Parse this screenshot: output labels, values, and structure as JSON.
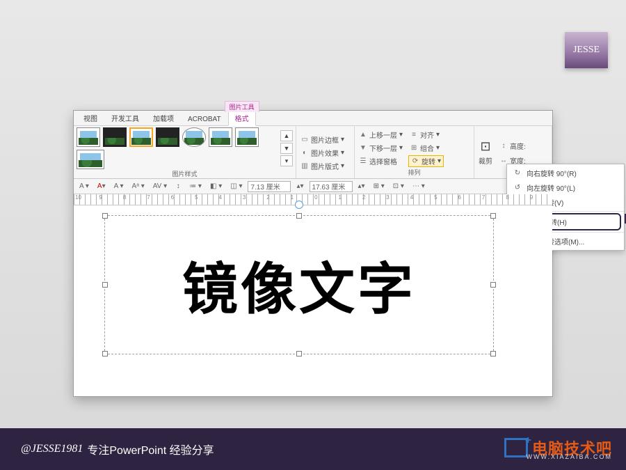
{
  "badge": {
    "text": "JESSE"
  },
  "tabs": {
    "view": "视图",
    "dev": "开发工具",
    "addins": "加载项",
    "acrobat": "ACROBAT",
    "format": "格式",
    "context_label": "图片工具"
  },
  "ribbon": {
    "styles_label": "图片样式",
    "border": "图片边框",
    "effects": "图片效果",
    "layout": "图片版式",
    "bring_forward": "上移一层",
    "send_backward": "下移一层",
    "selection_pane": "选择窗格",
    "align": "对齐",
    "group": "组合",
    "rotate": "旋转",
    "arrange_label": "排列",
    "crop": "裁剪",
    "height_label": "高度:",
    "width_label": "宽度:"
  },
  "toolbar2": {
    "height_value": "7.13 厘米",
    "width_value": "17.63 厘米"
  },
  "rotate_menu": {
    "right90": "向右旋转 90°(R)",
    "left90": "向左旋转 90°(L)",
    "flipv": "垂直翻转(V)",
    "fliph": "水平翻转(H)",
    "more": "其他旋转选项(M)..."
  },
  "canvas_text": "镜像文字",
  "ruler_numbers": [
    "10",
    "9",
    "8",
    "7",
    "6",
    "5",
    "4",
    "3",
    "2",
    "1",
    "0",
    "1",
    "2",
    "3",
    "4",
    "5",
    "6",
    "7",
    "8",
    "9"
  ],
  "footer": {
    "handle": "@JESSE1981",
    "tagline": "专注PowerPoint 经验分享",
    "logo_text": "电脑技术吧",
    "logo_sub": "WWW.XIAZAIBA.COM"
  }
}
